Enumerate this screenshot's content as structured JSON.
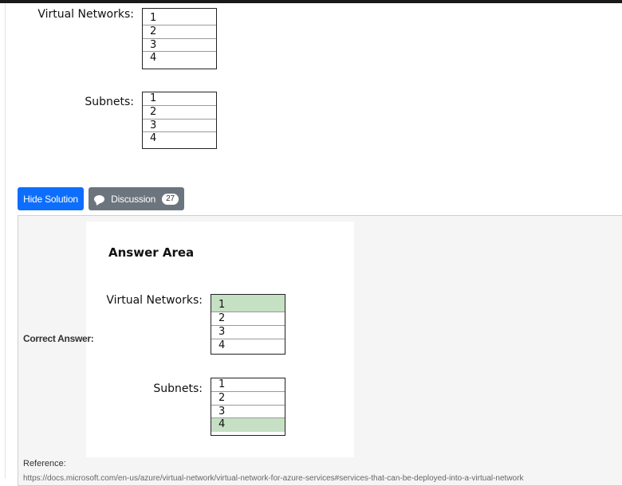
{
  "question": {
    "vnet": {
      "label": "Virtual Networks:",
      "options": [
        "1",
        "2",
        "3",
        "4"
      ]
    },
    "subnet": {
      "label": "Subnets:",
      "options": [
        "1",
        "2",
        "3",
        "4"
      ]
    }
  },
  "buttons": {
    "hide_solution": "Hide Solution",
    "discussion": "Discussion",
    "discussion_count": "27"
  },
  "solution": {
    "correct_label": "Correct Answer:",
    "answer_title": "Answer Area",
    "vnet": {
      "label": "Virtual Networks:",
      "options": [
        "1",
        "2",
        "3",
        "4"
      ],
      "selected": "1"
    },
    "subnet": {
      "label": "Subnets:",
      "options": [
        "1",
        "2",
        "3",
        "4"
      ],
      "selected": "4"
    },
    "selected_color": "#c5e0c3"
  },
  "reference": {
    "label": "Reference:",
    "url": "https://docs.microsoft.com/en-us/azure/virtual-network/virtual-network-for-azure-services#services-that-can-be-deployed-into-a-virtual-network"
  }
}
